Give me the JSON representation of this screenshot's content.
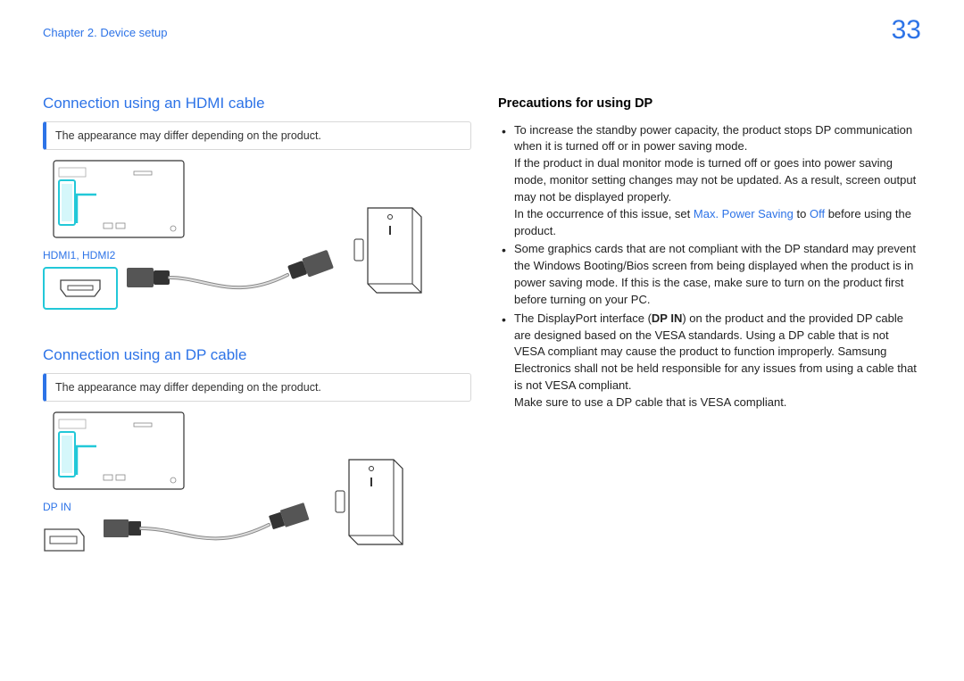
{
  "header": {
    "chapter": "Chapter 2. Device setup",
    "page_number": "33"
  },
  "left": {
    "hdmi": {
      "title": "Connection using an HDMI cable",
      "note": "The appearance may differ depending on the product.",
      "port_label": "HDMI1, HDMI2"
    },
    "dp": {
      "title": "Connection using an DP cable",
      "note": "The appearance may differ depending on the product.",
      "port_label": "DP IN"
    }
  },
  "right": {
    "title": "Precautions for using DP",
    "b1_line1": "To increase the standby power capacity, the product stops DP communication when it is turned off or in power saving mode.",
    "b1_line2": "If the product in dual monitor mode is turned off or goes into power saving mode, monitor setting changes may not be updated. As a result, screen output may not be displayed properly.",
    "b1_line3a": "In the occurrence of this issue, set ",
    "b1_hl1": "Max. Power Saving",
    "b1_line3b": " to ",
    "b1_hl2": "Off",
    "b1_line3c": " before using the product.",
    "b2": "Some graphics cards that are not compliant with the DP standard may prevent the Windows Booting/Bios screen from being displayed when the product is in power saving mode. If this is the case, make sure to turn on the product first before turning on your PC.",
    "b3_a": "The DisplayPort interface (",
    "b3_bold": "DP IN",
    "b3_b": ") on the product and the provided DP cable are designed based on the VESA standards. Using a DP cable that is not VESA compliant may cause the product to function improperly. Samsung Electronics shall not be held responsible for any issues from using a cable that is not VESA compliant.",
    "b3_line2": "Make sure to use a DP cable that is VESA compliant."
  }
}
